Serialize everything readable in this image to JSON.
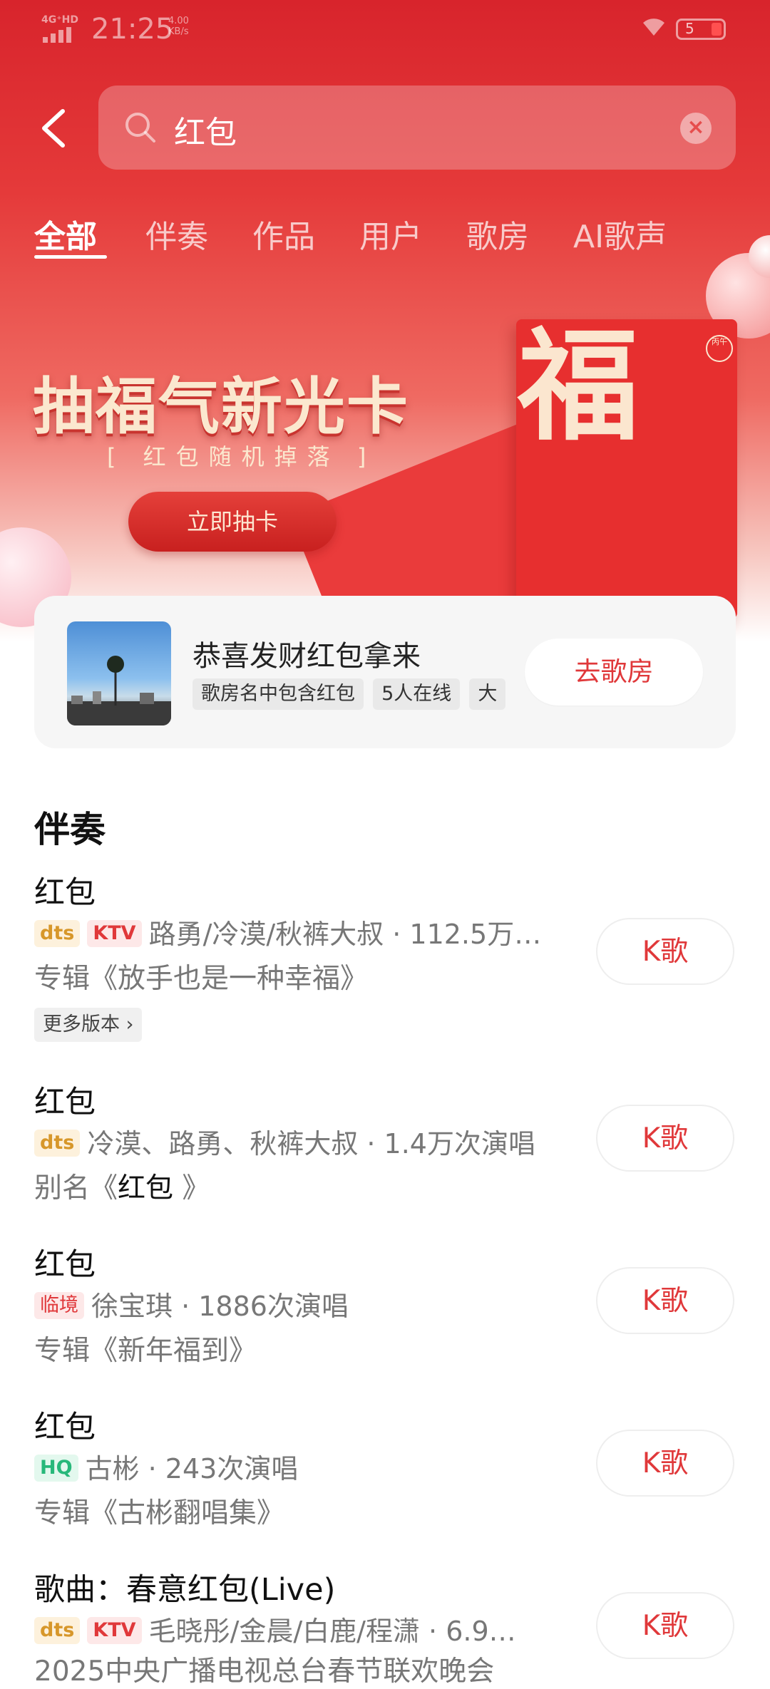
{
  "status_bar": {
    "network": "4G⁺HD",
    "time": "21:25",
    "speed_value": "4.00",
    "speed_unit": "KB/s",
    "battery": "5"
  },
  "search": {
    "query": "红包"
  },
  "tabs": [
    {
      "label": "全部",
      "active": true
    },
    {
      "label": "伴奏"
    },
    {
      "label": "作品"
    },
    {
      "label": "用户"
    },
    {
      "label": "歌房"
    },
    {
      "label": "AI歌声"
    }
  ],
  "banner": {
    "title": "抽福气新光卡",
    "subtitle": "[ 红包随机掉落 ]",
    "button": "立即抽卡",
    "envelope_char": "福",
    "seal_text": "丙午"
  },
  "room_card": {
    "title": "恭喜发财红包拿来",
    "tags": [
      "歌房名中包含红包",
      "5人在线",
      "大"
    ],
    "button": "去歌房"
  },
  "accompaniment_section": {
    "title": "伴奏",
    "songs": [
      {
        "title": "红包",
        "badges": [
          "dts",
          "KTV"
        ],
        "meta": "路勇/冷漠/秋裤大叔 · 112.5万…",
        "album_prefix": "专辑《放手也是一种幸福》",
        "more": "更多版本 ›",
        "button": "K歌"
      },
      {
        "title": "红包",
        "badges": [
          "dts"
        ],
        "meta": "冷漠、路勇、秋裤大叔 · 1.4万次演唱",
        "album_prefix": "别名《",
        "album_highlight": "红包",
        "album_suffix": " 》",
        "button": "K歌"
      },
      {
        "title": "红包",
        "badges": [
          "临境"
        ],
        "meta": "徐宝琪 · 1886次演唱",
        "album_prefix": "专辑《新年福到》",
        "button": "K歌"
      },
      {
        "title": "红包",
        "badges": [
          "HQ"
        ],
        "meta": "古彬 · 243次演唱",
        "album_prefix": "专辑《古彬翻唱集》",
        "button": "K歌"
      },
      {
        "title": "歌曲：春意红包(Live)",
        "badges": [
          "dts",
          "KTV"
        ],
        "meta": "毛晓彤/金晨/白鹿/程潇 · 6.9…",
        "album_prefix": "2025中央广播电视总台春节联欢晚会",
        "button": "K歌"
      }
    ]
  },
  "colors": {
    "accent": "#e0383a",
    "header_red": "#d8242c"
  }
}
